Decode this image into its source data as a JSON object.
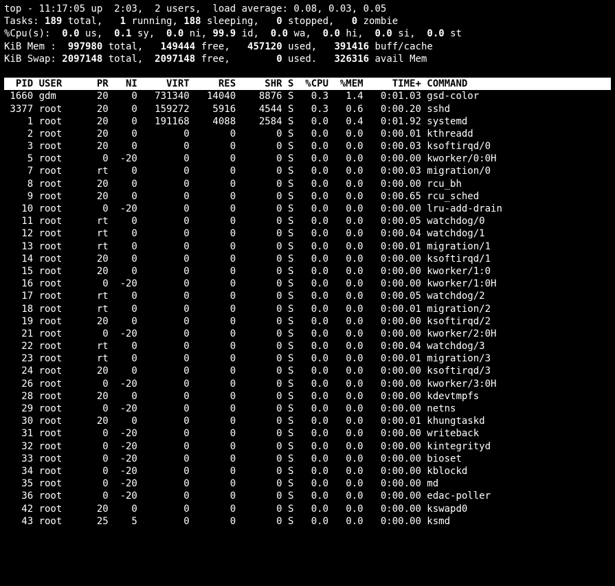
{
  "summary": {
    "line1_a": "top - ",
    "time": "11:17:05",
    "line1_b": " up  ",
    "uptime": "2:03",
    "line1_c": ",  ",
    "users": "2 users",
    "line1_d": ",  load average: ",
    "loadavg": "0.08, 0.03, 0.05",
    "tasks_label": "Tasks:",
    "tasks_total": "189 ",
    "tasks_total_s": "total,   ",
    "tasks_running": "1 ",
    "tasks_running_s": "running, ",
    "tasks_sleeping": "188 ",
    "tasks_sleeping_s": "sleeping,   ",
    "tasks_stopped": "0 ",
    "tasks_stopped_s": "stopped,   ",
    "tasks_zombie": "0 ",
    "tasks_zombie_s": "zombie",
    "cpu_label": "%Cpu(s):  ",
    "cpu_us": "0.0 ",
    "cpu_us_s": "us,  ",
    "cpu_sy": "0.1 ",
    "cpu_sy_s": "sy,  ",
    "cpu_ni": "0.0 ",
    "cpu_ni_s": "ni, ",
    "cpu_id": "99.9 ",
    "cpu_id_s": "id,  ",
    "cpu_wa": "0.0 ",
    "cpu_wa_s": "wa,  ",
    "cpu_hi": "0.0 ",
    "cpu_hi_s": "hi,  ",
    "cpu_si": "0.0 ",
    "cpu_si_s": "si,  ",
    "cpu_st": "0.0 ",
    "cpu_st_s": "st",
    "mem_label": "KiB Mem :  ",
    "mem_total": "997980 ",
    "mem_total_s": "total,   ",
    "mem_free": "149444 ",
    "mem_free_s": "free,   ",
    "mem_used": "457120 ",
    "mem_used_s": "used,   ",
    "mem_buff": "391416 ",
    "mem_buff_s": "buff/cache",
    "swap_label": "KiB Swap: ",
    "swap_total": "2097148 ",
    "swap_total_s": "total,  ",
    "swap_free": "2097148 ",
    "swap_free_s": "free,        ",
    "swap_used": "0 ",
    "swap_used_s": "used.   ",
    "swap_avail": "326316 ",
    "swap_avail_s": "avail Mem "
  },
  "columns": [
    "PID",
    "USER",
    "PR",
    "NI",
    "VIRT",
    "RES",
    "SHR",
    "S",
    "%CPU",
    "%MEM",
    "TIME+",
    "COMMAND"
  ],
  "processes": [
    {
      "pid": "1660",
      "user": "gdm",
      "pr": "20",
      "ni": "0",
      "virt": "731340",
      "res": "14040",
      "shr": "8876",
      "s": "S",
      "cpu": "0.3",
      "mem": "1.4",
      "time": "0:01.03",
      "cmd": "gsd-color"
    },
    {
      "pid": "3377",
      "user": "root",
      "pr": "20",
      "ni": "0",
      "virt": "159272",
      "res": "5916",
      "shr": "4544",
      "s": "S",
      "cpu": "0.3",
      "mem": "0.6",
      "time": "0:00.20",
      "cmd": "sshd"
    },
    {
      "pid": "1",
      "user": "root",
      "pr": "20",
      "ni": "0",
      "virt": "191168",
      "res": "4088",
      "shr": "2584",
      "s": "S",
      "cpu": "0.0",
      "mem": "0.4",
      "time": "0:01.92",
      "cmd": "systemd"
    },
    {
      "pid": "2",
      "user": "root",
      "pr": "20",
      "ni": "0",
      "virt": "0",
      "res": "0",
      "shr": "0",
      "s": "S",
      "cpu": "0.0",
      "mem": "0.0",
      "time": "0:00.01",
      "cmd": "kthreadd"
    },
    {
      "pid": "3",
      "user": "root",
      "pr": "20",
      "ni": "0",
      "virt": "0",
      "res": "0",
      "shr": "0",
      "s": "S",
      "cpu": "0.0",
      "mem": "0.0",
      "time": "0:00.03",
      "cmd": "ksoftirqd/0"
    },
    {
      "pid": "5",
      "user": "root",
      "pr": "0",
      "ni": "-20",
      "virt": "0",
      "res": "0",
      "shr": "0",
      "s": "S",
      "cpu": "0.0",
      "mem": "0.0",
      "time": "0:00.00",
      "cmd": "kworker/0:0H"
    },
    {
      "pid": "7",
      "user": "root",
      "pr": "rt",
      "ni": "0",
      "virt": "0",
      "res": "0",
      "shr": "0",
      "s": "S",
      "cpu": "0.0",
      "mem": "0.0",
      "time": "0:00.03",
      "cmd": "migration/0"
    },
    {
      "pid": "8",
      "user": "root",
      "pr": "20",
      "ni": "0",
      "virt": "0",
      "res": "0",
      "shr": "0",
      "s": "S",
      "cpu": "0.0",
      "mem": "0.0",
      "time": "0:00.00",
      "cmd": "rcu_bh"
    },
    {
      "pid": "9",
      "user": "root",
      "pr": "20",
      "ni": "0",
      "virt": "0",
      "res": "0",
      "shr": "0",
      "s": "S",
      "cpu": "0.0",
      "mem": "0.0",
      "time": "0:00.65",
      "cmd": "rcu_sched"
    },
    {
      "pid": "10",
      "user": "root",
      "pr": "0",
      "ni": "-20",
      "virt": "0",
      "res": "0",
      "shr": "0",
      "s": "S",
      "cpu": "0.0",
      "mem": "0.0",
      "time": "0:00.00",
      "cmd": "lru-add-drain"
    },
    {
      "pid": "11",
      "user": "root",
      "pr": "rt",
      "ni": "0",
      "virt": "0",
      "res": "0",
      "shr": "0",
      "s": "S",
      "cpu": "0.0",
      "mem": "0.0",
      "time": "0:00.05",
      "cmd": "watchdog/0"
    },
    {
      "pid": "12",
      "user": "root",
      "pr": "rt",
      "ni": "0",
      "virt": "0",
      "res": "0",
      "shr": "0",
      "s": "S",
      "cpu": "0.0",
      "mem": "0.0",
      "time": "0:00.04",
      "cmd": "watchdog/1"
    },
    {
      "pid": "13",
      "user": "root",
      "pr": "rt",
      "ni": "0",
      "virt": "0",
      "res": "0",
      "shr": "0",
      "s": "S",
      "cpu": "0.0",
      "mem": "0.0",
      "time": "0:00.01",
      "cmd": "migration/1"
    },
    {
      "pid": "14",
      "user": "root",
      "pr": "20",
      "ni": "0",
      "virt": "0",
      "res": "0",
      "shr": "0",
      "s": "S",
      "cpu": "0.0",
      "mem": "0.0",
      "time": "0:00.00",
      "cmd": "ksoftirqd/1"
    },
    {
      "pid": "15",
      "user": "root",
      "pr": "20",
      "ni": "0",
      "virt": "0",
      "res": "0",
      "shr": "0",
      "s": "S",
      "cpu": "0.0",
      "mem": "0.0",
      "time": "0:00.00",
      "cmd": "kworker/1:0"
    },
    {
      "pid": "16",
      "user": "root",
      "pr": "0",
      "ni": "-20",
      "virt": "0",
      "res": "0",
      "shr": "0",
      "s": "S",
      "cpu": "0.0",
      "mem": "0.0",
      "time": "0:00.00",
      "cmd": "kworker/1:0H"
    },
    {
      "pid": "17",
      "user": "root",
      "pr": "rt",
      "ni": "0",
      "virt": "0",
      "res": "0",
      "shr": "0",
      "s": "S",
      "cpu": "0.0",
      "mem": "0.0",
      "time": "0:00.05",
      "cmd": "watchdog/2"
    },
    {
      "pid": "18",
      "user": "root",
      "pr": "rt",
      "ni": "0",
      "virt": "0",
      "res": "0",
      "shr": "0",
      "s": "S",
      "cpu": "0.0",
      "mem": "0.0",
      "time": "0:00.01",
      "cmd": "migration/2"
    },
    {
      "pid": "19",
      "user": "root",
      "pr": "20",
      "ni": "0",
      "virt": "0",
      "res": "0",
      "shr": "0",
      "s": "S",
      "cpu": "0.0",
      "mem": "0.0",
      "time": "0:00.00",
      "cmd": "ksoftirqd/2"
    },
    {
      "pid": "21",
      "user": "root",
      "pr": "0",
      "ni": "-20",
      "virt": "0",
      "res": "0",
      "shr": "0",
      "s": "S",
      "cpu": "0.0",
      "mem": "0.0",
      "time": "0:00.00",
      "cmd": "kworker/2:0H"
    },
    {
      "pid": "22",
      "user": "root",
      "pr": "rt",
      "ni": "0",
      "virt": "0",
      "res": "0",
      "shr": "0",
      "s": "S",
      "cpu": "0.0",
      "mem": "0.0",
      "time": "0:00.04",
      "cmd": "watchdog/3"
    },
    {
      "pid": "23",
      "user": "root",
      "pr": "rt",
      "ni": "0",
      "virt": "0",
      "res": "0",
      "shr": "0",
      "s": "S",
      "cpu": "0.0",
      "mem": "0.0",
      "time": "0:00.01",
      "cmd": "migration/3"
    },
    {
      "pid": "24",
      "user": "root",
      "pr": "20",
      "ni": "0",
      "virt": "0",
      "res": "0",
      "shr": "0",
      "s": "S",
      "cpu": "0.0",
      "mem": "0.0",
      "time": "0:00.00",
      "cmd": "ksoftirqd/3"
    },
    {
      "pid": "26",
      "user": "root",
      "pr": "0",
      "ni": "-20",
      "virt": "0",
      "res": "0",
      "shr": "0",
      "s": "S",
      "cpu": "0.0",
      "mem": "0.0",
      "time": "0:00.00",
      "cmd": "kworker/3:0H"
    },
    {
      "pid": "28",
      "user": "root",
      "pr": "20",
      "ni": "0",
      "virt": "0",
      "res": "0",
      "shr": "0",
      "s": "S",
      "cpu": "0.0",
      "mem": "0.0",
      "time": "0:00.00",
      "cmd": "kdevtmpfs"
    },
    {
      "pid": "29",
      "user": "root",
      "pr": "0",
      "ni": "-20",
      "virt": "0",
      "res": "0",
      "shr": "0",
      "s": "S",
      "cpu": "0.0",
      "mem": "0.0",
      "time": "0:00.00",
      "cmd": "netns"
    },
    {
      "pid": "30",
      "user": "root",
      "pr": "20",
      "ni": "0",
      "virt": "0",
      "res": "0",
      "shr": "0",
      "s": "S",
      "cpu": "0.0",
      "mem": "0.0",
      "time": "0:00.01",
      "cmd": "khungtaskd"
    },
    {
      "pid": "31",
      "user": "root",
      "pr": "0",
      "ni": "-20",
      "virt": "0",
      "res": "0",
      "shr": "0",
      "s": "S",
      "cpu": "0.0",
      "mem": "0.0",
      "time": "0:00.00",
      "cmd": "writeback"
    },
    {
      "pid": "32",
      "user": "root",
      "pr": "0",
      "ni": "-20",
      "virt": "0",
      "res": "0",
      "shr": "0",
      "s": "S",
      "cpu": "0.0",
      "mem": "0.0",
      "time": "0:00.00",
      "cmd": "kintegrityd"
    },
    {
      "pid": "33",
      "user": "root",
      "pr": "0",
      "ni": "-20",
      "virt": "0",
      "res": "0",
      "shr": "0",
      "s": "S",
      "cpu": "0.0",
      "mem": "0.0",
      "time": "0:00.00",
      "cmd": "bioset"
    },
    {
      "pid": "34",
      "user": "root",
      "pr": "0",
      "ni": "-20",
      "virt": "0",
      "res": "0",
      "shr": "0",
      "s": "S",
      "cpu": "0.0",
      "mem": "0.0",
      "time": "0:00.00",
      "cmd": "kblockd"
    },
    {
      "pid": "35",
      "user": "root",
      "pr": "0",
      "ni": "-20",
      "virt": "0",
      "res": "0",
      "shr": "0",
      "s": "S",
      "cpu": "0.0",
      "mem": "0.0",
      "time": "0:00.00",
      "cmd": "md"
    },
    {
      "pid": "36",
      "user": "root",
      "pr": "0",
      "ni": "-20",
      "virt": "0",
      "res": "0",
      "shr": "0",
      "s": "S",
      "cpu": "0.0",
      "mem": "0.0",
      "time": "0:00.00",
      "cmd": "edac-poller"
    },
    {
      "pid": "42",
      "user": "root",
      "pr": "20",
      "ni": "0",
      "virt": "0",
      "res": "0",
      "shr": "0",
      "s": "S",
      "cpu": "0.0",
      "mem": "0.0",
      "time": "0:00.00",
      "cmd": "kswapd0"
    },
    {
      "pid": "43",
      "user": "root",
      "pr": "25",
      "ni": "5",
      "virt": "0",
      "res": "0",
      "shr": "0",
      "s": "S",
      "cpu": "0.0",
      "mem": "0.0",
      "time": "0:00.00",
      "cmd": "ksmd"
    }
  ]
}
